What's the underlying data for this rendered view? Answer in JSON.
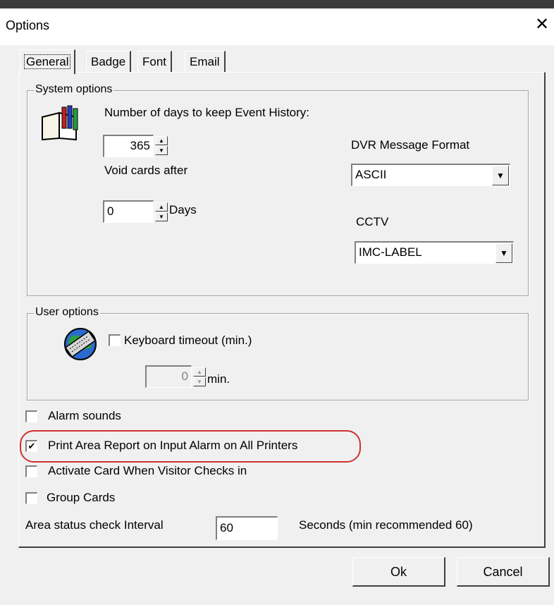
{
  "window": {
    "title": "Options",
    "close_glyph": "✕"
  },
  "tabs": [
    {
      "label": "General",
      "active": true
    },
    {
      "label": "Badge",
      "active": false
    },
    {
      "label": "Font",
      "active": false
    },
    {
      "label": "Email",
      "active": false
    }
  ],
  "system_options": {
    "legend": "System options",
    "icon": "book-icon",
    "history_label": "Number of days to keep Event History:",
    "history_days": "365",
    "void_label": "Void cards after",
    "void_days": "0",
    "days_suffix": "Days",
    "dvr_label": "DVR Message Format",
    "dvr_value": "ASCII",
    "cctv_label": "CCTV",
    "cctv_value": "IMC-LABEL"
  },
  "user_options": {
    "legend": "User options",
    "icon": "keyboard-globe-icon",
    "keyboard_timeout_label": "Keyboard timeout (min.)",
    "keyboard_timeout_checked": false,
    "timeout_value": "0",
    "min_suffix": "min."
  },
  "checkboxes": [
    {
      "label": "Alarm sounds",
      "checked": false
    },
    {
      "label": "Print Area Report on Input Alarm on All Printers",
      "checked": true
    },
    {
      "label": "Activate Card When Visitor Checks in",
      "checked": false
    },
    {
      "label": "Group Cards",
      "checked": false
    }
  ],
  "area_status": {
    "label": "Area status check Interval",
    "value": "60",
    "suffix": "Seconds (min recommended 60)"
  },
  "buttons": {
    "ok": "Ok",
    "cancel": "Cancel"
  },
  "colors": {
    "highlight": "#d03030",
    "dialog_bg": "#f0f0f0"
  }
}
